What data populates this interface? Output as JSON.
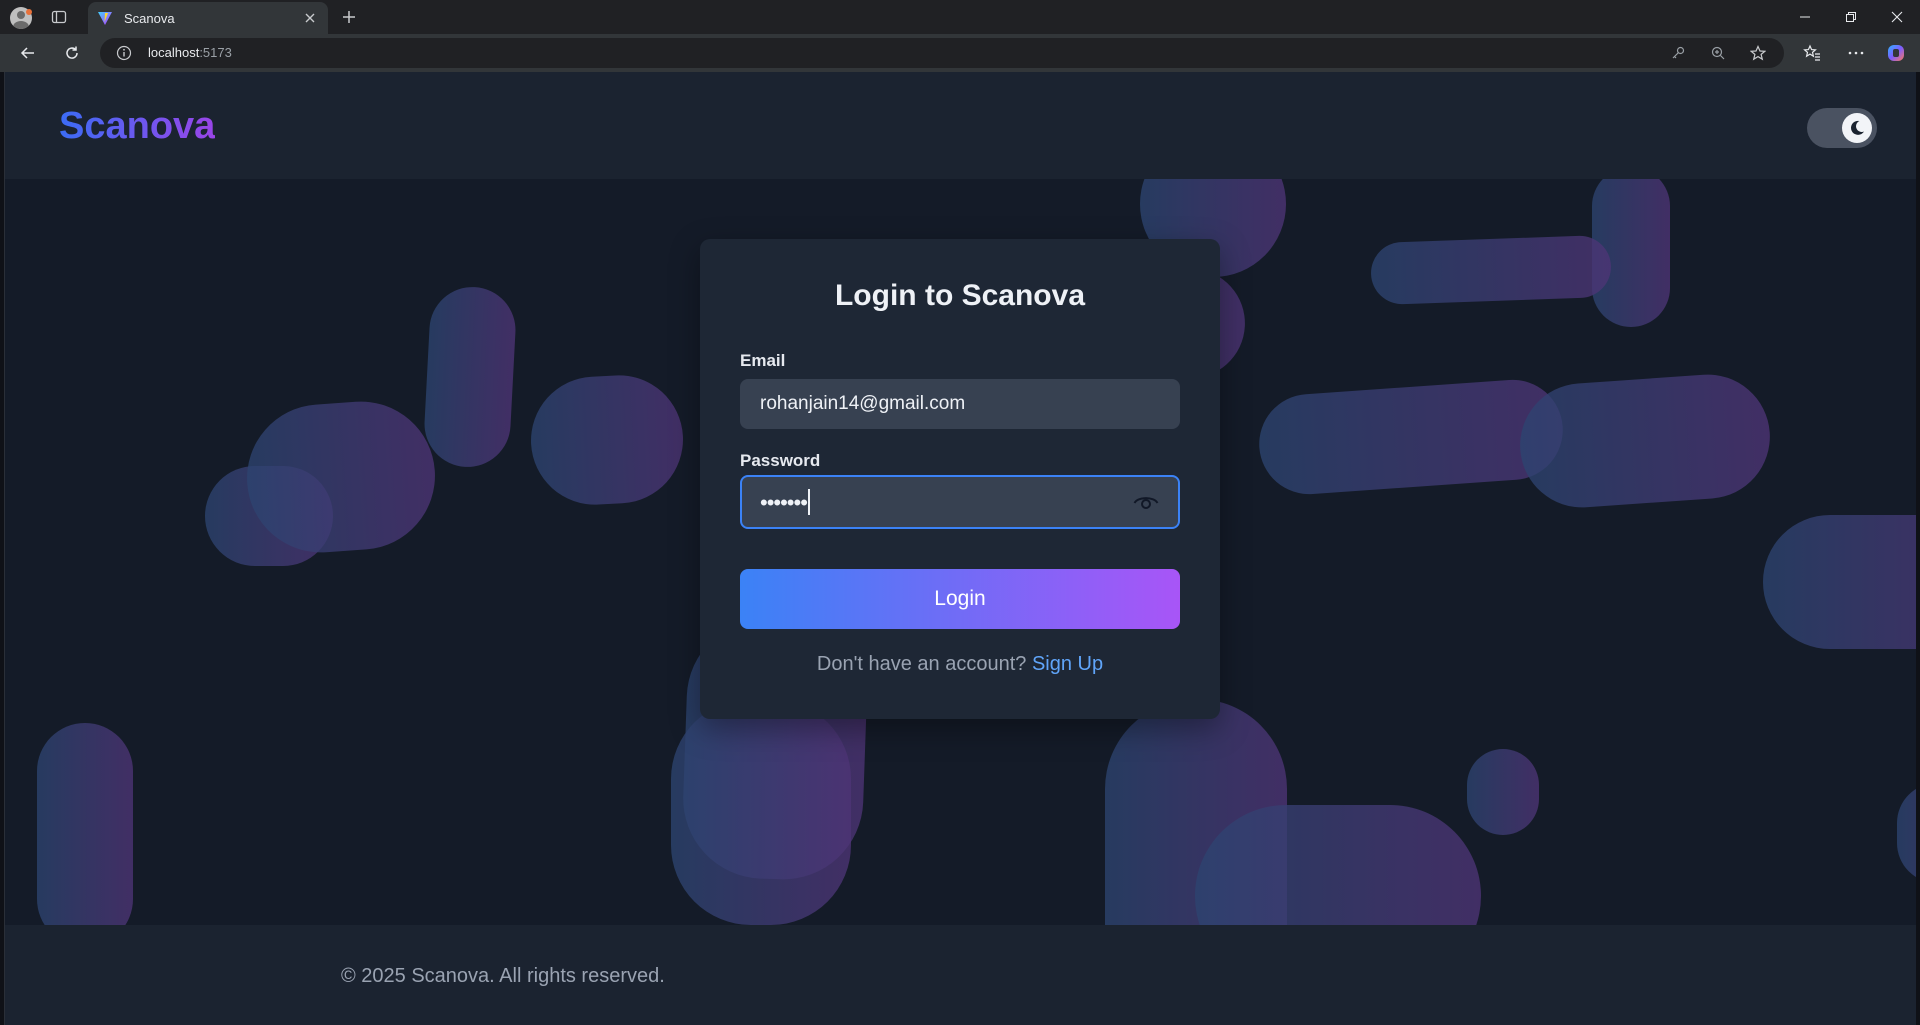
{
  "browser": {
    "tab_title": "Scanova",
    "url_host": "localhost",
    "url_port": ":5173"
  },
  "app": {
    "brand": "Scanova",
    "theme_toggle_state": "dark"
  },
  "login": {
    "title": "Login to Scanova",
    "email_label": "Email",
    "email_value": "rohanjain14@gmail.com",
    "password_label": "Password",
    "password_mask": "•••••••",
    "login_button": "Login",
    "no_account_text": "Don't have an account?",
    "signup_link": "Sign Up"
  },
  "footer": {
    "copyright": "© 2025 Scanova. All rights reserved."
  },
  "colors": {
    "accent_blue": "#3b82f6",
    "accent_purple": "#a855f7",
    "link": "#60a5fa",
    "card_bg": "#1e2735"
  }
}
